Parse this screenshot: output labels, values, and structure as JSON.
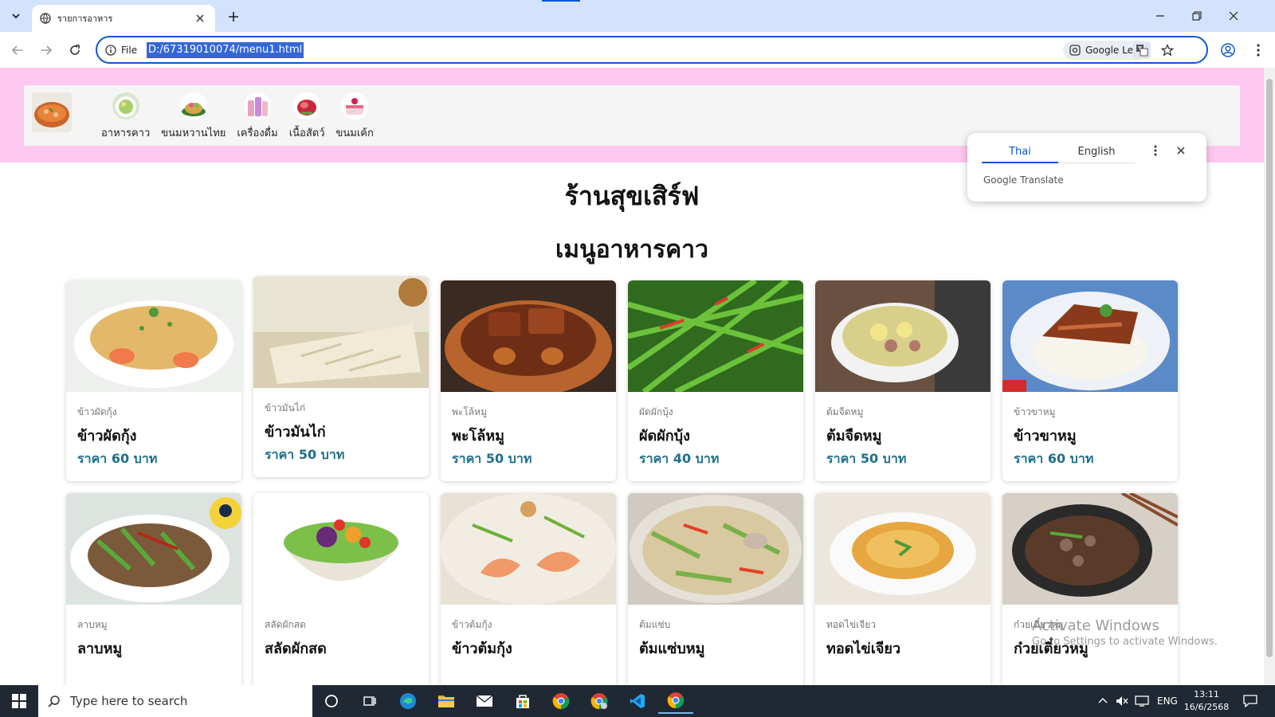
{
  "browser": {
    "tab_title": "รายการอาหาร",
    "site_label": "File",
    "url": "D:/67319010074/menu1.html",
    "lens_label": "Google Lens"
  },
  "nav": {
    "logo_icon": "tom-yum-bowl-icon",
    "items": [
      {
        "label": "อาหารคาว",
        "icon": "savory-food-icon"
      },
      {
        "label": "ขนมหวานไทย",
        "icon": "thai-dessert-icon"
      },
      {
        "label": "เครื่องดื่ม",
        "icon": "drinks-icon"
      },
      {
        "label": "เนื้อสัตว์",
        "icon": "meat-icon"
      },
      {
        "label": "ขนมเค้ก",
        "icon": "cake-icon"
      }
    ]
  },
  "page": {
    "shop_name": "ร้านสุขเสิร์ฟ",
    "menu_title": "เมนูอาหารคาว"
  },
  "menu_items": [
    {
      "category": "ข้าวผัดกุ้ง",
      "name": "ข้าวผัดกุ้ง",
      "price": "ราคา 60 บาท"
    },
    {
      "category": "ข้าวมันไก่",
      "name": "ข้าวมันไก่",
      "price": "ราคา 50 บาท"
    },
    {
      "category": "พะโล้หมู",
      "name": "พะโล้หมู",
      "price": "ราคา 50 บาท"
    },
    {
      "category": "ผัดผักบุ้ง",
      "name": "ผัดผักบุ้ง",
      "price": "ราคา 40 บาท"
    },
    {
      "category": "ต้มจืดหมู",
      "name": "ต้มจืดหมู",
      "price": "ราคา 50 บาท"
    },
    {
      "category": "ข้าวขาหมู",
      "name": "ข้าวขาหมู",
      "price": "ราคา 60 บาท"
    },
    {
      "category": "ลาบหมู",
      "name": "ลาบหมู",
      "price": ""
    },
    {
      "category": "สลัดผักสด",
      "name": "สลัดผักสด",
      "price": ""
    },
    {
      "category": "ข้าวต้มกุ้ง",
      "name": "ข้าวต้มกุ้ง",
      "price": ""
    },
    {
      "category": "ต้มแซ่บ",
      "name": "ต้มแซ่บหมู",
      "price": ""
    },
    {
      "category": "ทอดไข่เจียว",
      "name": "ทอดไข่เจียว",
      "price": ""
    },
    {
      "category": "ก๋วยเตี๋ยวหมู",
      "name": "ก๋วยเตี๋ยวหมู",
      "price": ""
    }
  ],
  "translate_popup": {
    "tab_source": "Thai",
    "tab_target": "English",
    "brand": "Google Translate"
  },
  "watermark": {
    "line1": "Activate Windows",
    "line2": "Go to Settings to activate Windows."
  },
  "taskbar": {
    "search_placeholder": "Type here to search",
    "language": "ENG",
    "time": "13:11",
    "date": "16/6/2568"
  },
  "colors": {
    "navbar_bg": "#ffc8f0",
    "price_text": "#1f6f8b",
    "browser_accent": "#0b57d0"
  }
}
